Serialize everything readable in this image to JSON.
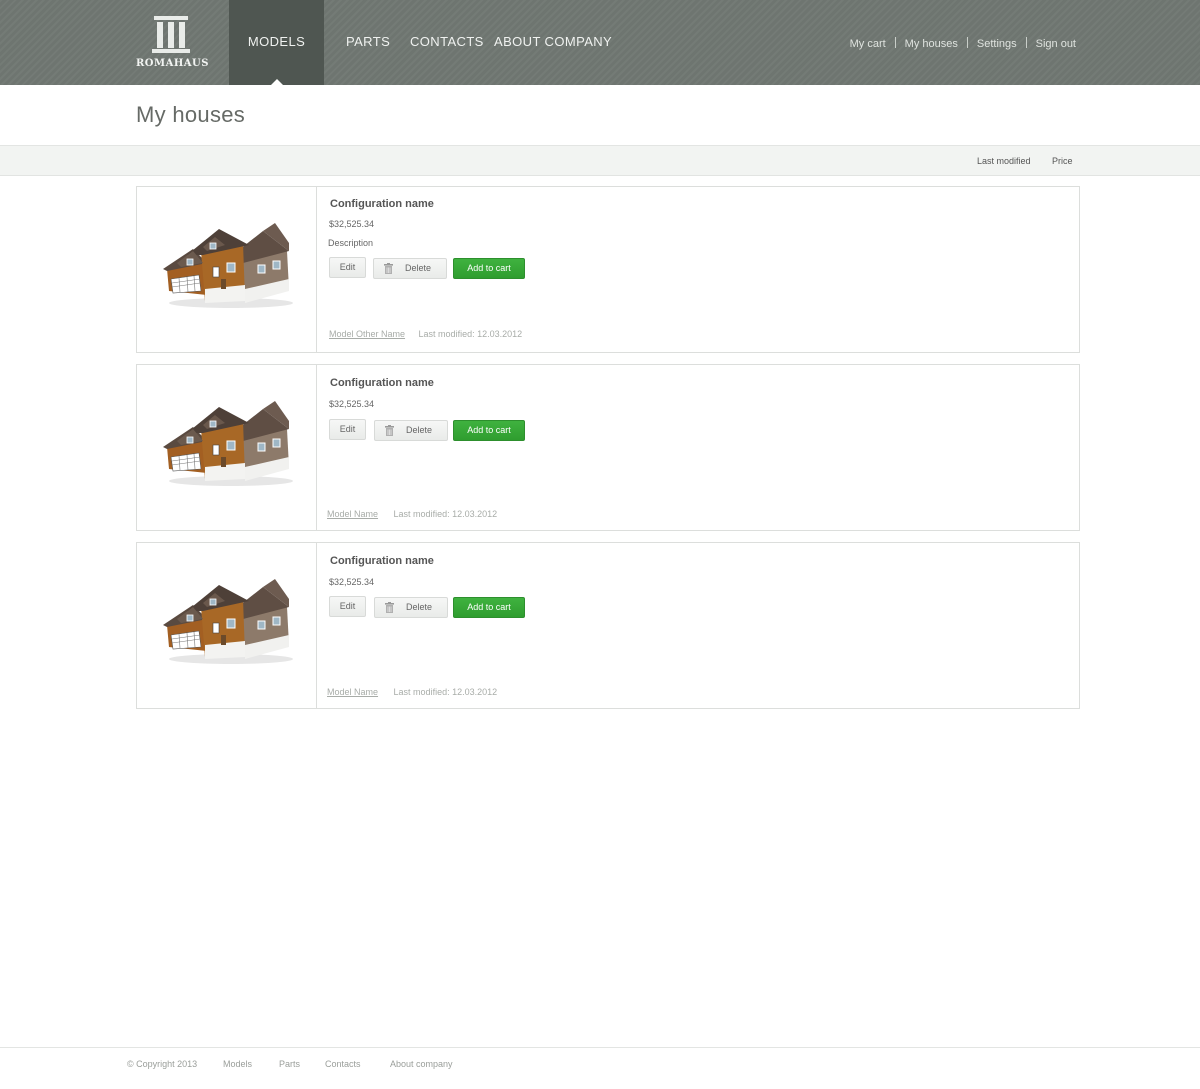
{
  "brand": {
    "name": "ROMAHAUS"
  },
  "nav": {
    "items": [
      {
        "label": "MODELS",
        "active": true
      },
      {
        "label": "PARTS",
        "active": false
      },
      {
        "label": "CONTACTS",
        "active": false
      },
      {
        "label": "ABOUT COMPANY",
        "active": false
      }
    ]
  },
  "user_links": [
    "My cart",
    "My houses",
    "Settings",
    "Sign out"
  ],
  "page": {
    "title": "My houses"
  },
  "sort": [
    "Last modified",
    "Price"
  ],
  "houses": [
    {
      "name": "Configuration name",
      "price": "$32,525.34",
      "description": "Description",
      "edit_label": "Edit",
      "delete_label": "Delete",
      "cart_label": "Add to cart",
      "model": "Model Other Name",
      "modified": "Last modified: 12.03.2012"
    },
    {
      "name": "Configuration name",
      "price": "$32,525.34",
      "edit_label": "Edit",
      "delete_label": "Delete",
      "cart_label": "Add to cart",
      "model": "Model Name",
      "modified": "Last modified: 12.03.2012"
    },
    {
      "name": "Configuration name",
      "price": "$32,525.34",
      "edit_label": "Edit",
      "delete_label": "Delete",
      "cart_label": "Add to cart",
      "model": "Model Name",
      "modified": "Last modified: 12.03.2012"
    }
  ],
  "footer": {
    "copyright": "© Copyright 2013",
    "links": [
      "Models",
      "Parts",
      "Contacts",
      "About company"
    ]
  },
  "colors": {
    "header": "#6e7570",
    "nav_active": "#4f5651",
    "accent_green": "#35a535"
  },
  "icons": {
    "delete": "trash-icon",
    "house": "house-image"
  }
}
